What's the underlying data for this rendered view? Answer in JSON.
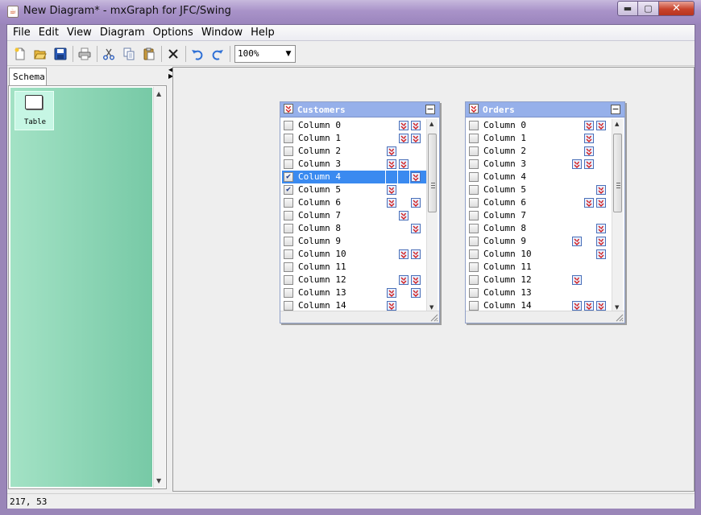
{
  "window": {
    "title": "New Diagram* - mxGraph for JFC/Swing",
    "app_icon": "java-coffee-cup-icon",
    "controls": [
      "minimize-icon",
      "maximize-icon",
      "close-icon"
    ]
  },
  "menubar": {
    "items": [
      "File",
      "Edit",
      "View",
      "Diagram",
      "Options",
      "Window",
      "Help"
    ]
  },
  "toolbar": {
    "buttons": [
      "new-icon",
      "open-icon",
      "save-icon",
      "print-icon",
      "cut-icon",
      "copy-icon",
      "paste-icon",
      "delete-icon",
      "undo-icon",
      "redo-icon"
    ],
    "zoom": "100%"
  },
  "palette": {
    "tab_label": "Schema",
    "tools": [
      {
        "label": "Table",
        "icon": "table-shape-icon"
      }
    ]
  },
  "tables": [
    {
      "title": "Customers",
      "rows": [
        {
          "name": "Column 0",
          "checked": false,
          "selected": false,
          "flags": [
            false,
            true,
            true
          ]
        },
        {
          "name": "Column 1",
          "checked": false,
          "selected": false,
          "flags": [
            false,
            true,
            true
          ]
        },
        {
          "name": "Column 2",
          "checked": false,
          "selected": false,
          "flags": [
            true,
            false,
            false
          ]
        },
        {
          "name": "Column 3",
          "checked": false,
          "selected": false,
          "flags": [
            true,
            true,
            false
          ]
        },
        {
          "name": "Column 4",
          "checked": true,
          "selected": true,
          "flags": [
            false,
            false,
            true
          ]
        },
        {
          "name": "Column 5",
          "checked": true,
          "selected": false,
          "flags": [
            true,
            false,
            false
          ]
        },
        {
          "name": "Column 6",
          "checked": false,
          "selected": false,
          "flags": [
            true,
            false,
            true
          ]
        },
        {
          "name": "Column 7",
          "checked": false,
          "selected": false,
          "flags": [
            false,
            true,
            false
          ]
        },
        {
          "name": "Column 8",
          "checked": false,
          "selected": false,
          "flags": [
            false,
            false,
            true
          ]
        },
        {
          "name": "Column 9",
          "checked": false,
          "selected": false,
          "flags": [
            false,
            false,
            false
          ]
        },
        {
          "name": "Column 10",
          "checked": false,
          "selected": false,
          "flags": [
            false,
            true,
            true
          ]
        },
        {
          "name": "Column 11",
          "checked": false,
          "selected": false,
          "flags": [
            false,
            false,
            false
          ]
        },
        {
          "name": "Column 12",
          "checked": false,
          "selected": false,
          "flags": [
            false,
            true,
            true
          ]
        },
        {
          "name": "Column 13",
          "checked": false,
          "selected": false,
          "flags": [
            true,
            false,
            true
          ]
        },
        {
          "name": "Column 14",
          "checked": false,
          "selected": false,
          "flags": [
            true,
            false,
            false
          ]
        }
      ]
    },
    {
      "title": "Orders",
      "rows": [
        {
          "name": "Column 0",
          "checked": false,
          "selected": false,
          "flags": [
            false,
            true,
            true
          ]
        },
        {
          "name": "Column 1",
          "checked": false,
          "selected": false,
          "flags": [
            false,
            true,
            false
          ]
        },
        {
          "name": "Column 2",
          "checked": false,
          "selected": false,
          "flags": [
            false,
            true,
            false
          ]
        },
        {
          "name": "Column 3",
          "checked": false,
          "selected": false,
          "flags": [
            true,
            true,
            false
          ]
        },
        {
          "name": "Column 4",
          "checked": false,
          "selected": false,
          "flags": [
            false,
            false,
            false
          ]
        },
        {
          "name": "Column 5",
          "checked": false,
          "selected": false,
          "flags": [
            false,
            false,
            true
          ]
        },
        {
          "name": "Column 6",
          "checked": false,
          "selected": false,
          "flags": [
            false,
            true,
            true
          ]
        },
        {
          "name": "Column 7",
          "checked": false,
          "selected": false,
          "flags": [
            false,
            false,
            false
          ]
        },
        {
          "name": "Column 8",
          "checked": false,
          "selected": false,
          "flags": [
            false,
            false,
            true
          ]
        },
        {
          "name": "Column 9",
          "checked": false,
          "selected": false,
          "flags": [
            true,
            false,
            true
          ]
        },
        {
          "name": "Column 10",
          "checked": false,
          "selected": false,
          "flags": [
            false,
            false,
            true
          ]
        },
        {
          "name": "Column 11",
          "checked": false,
          "selected": false,
          "flags": [
            false,
            false,
            false
          ]
        },
        {
          "name": "Column 12",
          "checked": false,
          "selected": false,
          "flags": [
            true,
            false,
            false
          ]
        },
        {
          "name": "Column 13",
          "checked": false,
          "selected": false,
          "flags": [
            false,
            false,
            false
          ]
        },
        {
          "name": "Column 14",
          "checked": false,
          "selected": false,
          "flags": [
            true,
            true,
            true
          ]
        }
      ]
    }
  ],
  "status": {
    "text": "217, 53"
  },
  "colors": {
    "table_header": "#96b0ea",
    "selection": "#3a8af0",
    "palette_start": "#a3e2c5",
    "palette_end": "#77c9a6",
    "title_bar": "#a993c9"
  }
}
